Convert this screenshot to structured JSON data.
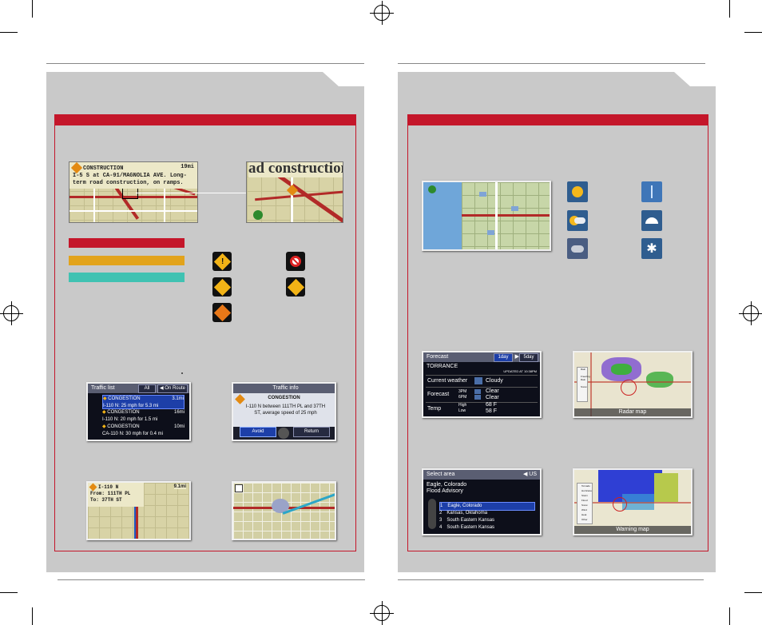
{
  "left_page": {
    "traffic_map": {
      "banner_label": "CONSTRUCTION",
      "banner_distance": "19mi",
      "banner_text_line1": "I-5 S at CA-91/MAGNOLIA AVE. Long-",
      "banner_text_line2": "term road construction, on ramps.",
      "zoom_text": "ad construction, on"
    },
    "legend_colors": [
      "#c4162a",
      "#e2a31c",
      "#40c2b2"
    ],
    "traffic_icons": [
      "incident-icon",
      "road-closed-icon",
      "accident-icon",
      "weather-hazard-icon",
      "construction-icon"
    ],
    "traffic_list": {
      "header": "Traffic list",
      "tab_all": "All",
      "tab_on_route": "On Route",
      "items": [
        {
          "title": "CONGESTION",
          "distance": "3.1mi",
          "detail": "I-110 N: 25 mph for 5.3 mi"
        },
        {
          "title": "CONGESTION",
          "distance": "16mi",
          "detail": "I-110 N: 20 mph for 1.5 mi"
        },
        {
          "title": "CONGESTION",
          "distance": "10mi",
          "detail": "CA-110 N: 30 mph for 0.4 mi"
        }
      ]
    },
    "traffic_info": {
      "header": "Traffic info",
      "title": "CONGESTION",
      "text_line1": "I-110 N between 111TH PL and 37TH",
      "text_line2": "ST, average speed of 25 mph",
      "avoid_button": "Avoid",
      "return_button": "Return"
    },
    "route_map": {
      "line1": "I-110 N",
      "line2": "From: 111TH PL",
      "line3": "To: 37TH ST",
      "distance": "9.1mi"
    }
  },
  "right_page": {
    "weather_icons": [
      "sunny-icon",
      "rain-icon",
      "partly-cloudy-icon",
      "showers-icon",
      "cloudy-icon",
      "snow-icon"
    ],
    "forecast": {
      "header": "Forecast",
      "tab_1day": "1day",
      "tab_5day": "5day",
      "city": "TORRANCE",
      "updated": "UPDATED AT 10:38PM",
      "current_weather_label": "Current weather",
      "current_weather_value": "Cloudy",
      "forecast_label": "Forecast",
      "forecast_time1": "3PM",
      "forecast_value1": "Clear",
      "forecast_time2": "6PM",
      "forecast_value2": "Clear",
      "temp_label": "Temp",
      "high_label": "High",
      "high_value": "68 F",
      "low_label": "Low",
      "low_value": "58 F"
    },
    "radar_map": {
      "caption": "Radar map",
      "legend": [
        "Rain",
        "Freezing Rain",
        "Snow"
      ]
    },
    "select_area": {
      "header": "Select area",
      "header_right": "US",
      "title_line1": "Eagle, Colorado",
      "title_line2": "Flood Advisory",
      "items": [
        "Eagle, Colorado",
        "Kansas, Oklahoma",
        "South Eastern Kansas",
        "South Eastern Kansas"
      ]
    },
    "warning_map": {
      "caption": "Warning map",
      "legend": [
        "Tornado",
        "Hurricane",
        "Storm",
        "Flood",
        "Snow",
        "Wind",
        "Heat",
        "Other"
      ]
    }
  }
}
